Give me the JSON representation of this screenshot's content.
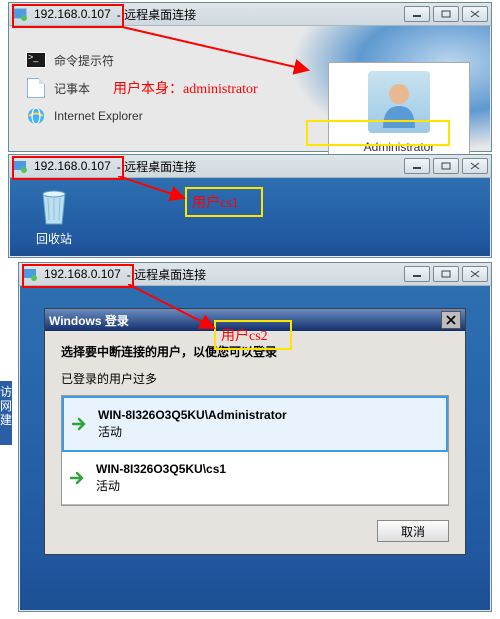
{
  "ip": "192.168.0.107",
  "title_suffix": "- 远程桌面连接",
  "win1": {
    "icons": {
      "cmd": "命令提示符",
      "notepad": "记事本",
      "ie": "Internet Explorer"
    },
    "user_tile": "Administrator",
    "note": "用户本身：administrator"
  },
  "win2": {
    "recycle": "回收站",
    "note": "用户cs1"
  },
  "win3": {
    "dlg_title": "Windows 登录",
    "heading": "选择要中断连接的用户，以便您可以登录",
    "sub": "已登录的用户过多",
    "sessions": [
      {
        "path": "WIN-8I326O3Q5KU\\Administrator",
        "status": "活动"
      },
      {
        "path": "WIN-8I326O3Q5KU\\cs1",
        "status": "活动"
      }
    ],
    "cancel": "取消",
    "note": "用户cs2"
  },
  "sidefrag": "访网建"
}
